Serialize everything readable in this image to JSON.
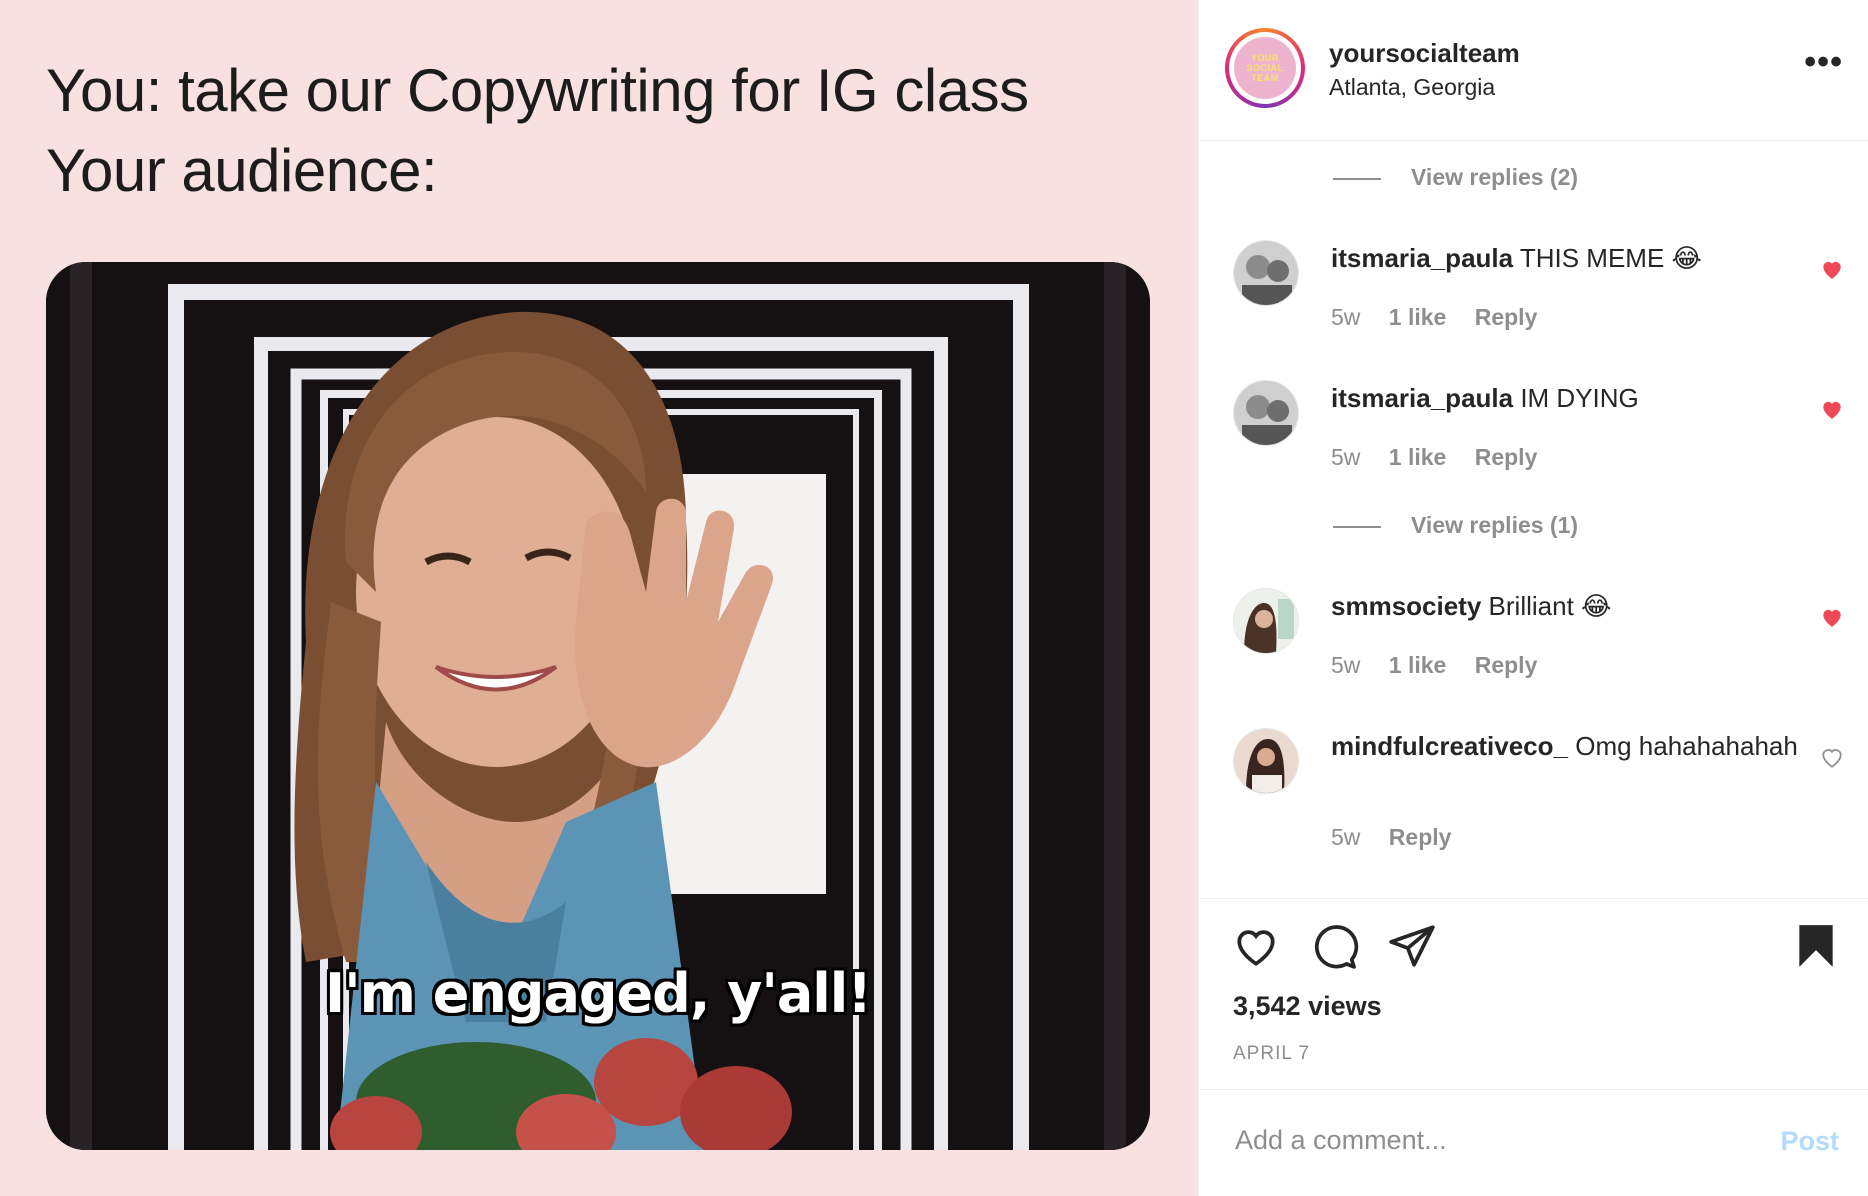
{
  "meme": {
    "line1": "You: take our Copywriting for IG class",
    "line2": "Your audience:",
    "gif_caption": "I'm engaged, y'all!"
  },
  "post": {
    "username": "yoursocialteam",
    "location": "Atlanta, Georgia",
    "avatar_logo_text": "YOUR SOCIAL TEAM",
    "views": "3,542 views",
    "date": "APRIL 7",
    "add_comment_placeholder": "Add a comment...",
    "post_label": "Post"
  },
  "comments": {
    "view_replies_top": "View replies (2)",
    "view_replies_mid": "View replies (1)",
    "items": [
      {
        "user": "itsmaria_paula",
        "text": "THIS MEME 😂",
        "age": "5w",
        "likes": "1 like",
        "reply": "Reply",
        "liked": true
      },
      {
        "user": "itsmaria_paula",
        "text": "IM DYING",
        "age": "5w",
        "likes": "1 like",
        "reply": "Reply",
        "liked": true
      },
      {
        "user": "smmsociety",
        "text": "Brilliant 😂",
        "age": "5w",
        "likes": "1 like",
        "reply": "Reply",
        "liked": true
      },
      {
        "user": "mindfulcreativeco_",
        "text": "Omg hahahahahah",
        "age": "5w",
        "reply": "Reply",
        "liked": false
      }
    ]
  },
  "colors": {
    "like_red": "#ed4956",
    "muted_text": "#8e8e8e",
    "media_bg": "#f8e1e0",
    "post_disabled": "#b3dbff"
  },
  "icons": [
    "heart-icon",
    "comment-icon",
    "share-icon",
    "bookmark-icon",
    "more-options-icon"
  ]
}
